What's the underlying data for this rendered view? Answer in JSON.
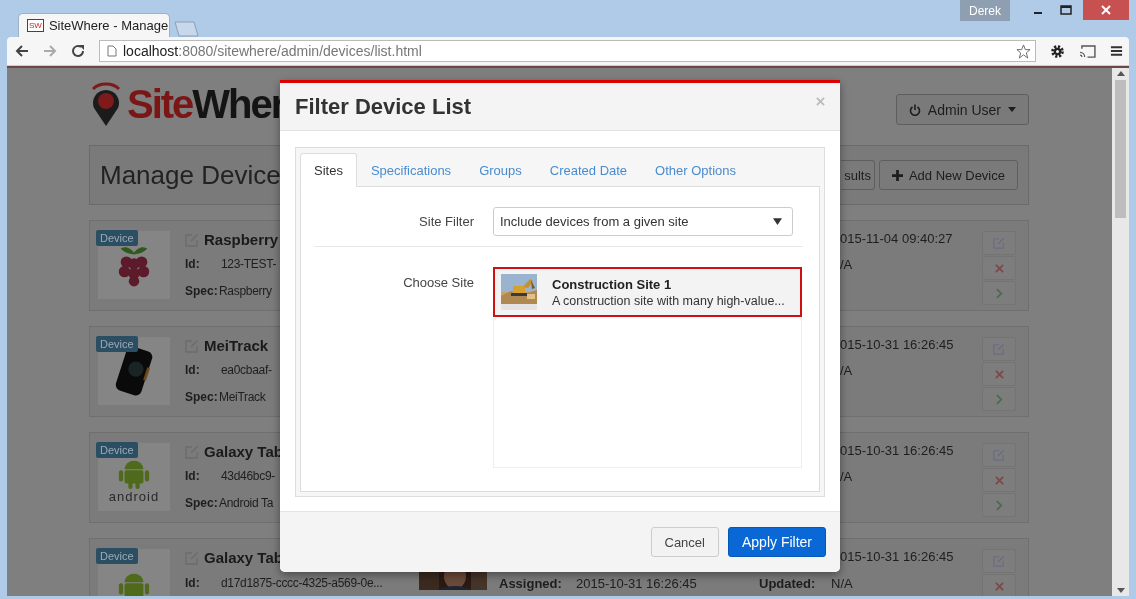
{
  "browser": {
    "tab_favicon": "SW",
    "tab_title": "SiteWhere - Manage",
    "profile": "Derek",
    "url_host": "localhost",
    "url_path": ":8080/sitewhere/admin/devices/list.html"
  },
  "page": {
    "logo": {
      "accent": "Site",
      "rest": "Wher"
    },
    "user_menu": "Admin User",
    "heading": "Manage Device",
    "toolbar_buttons": [
      {
        "label": "sults",
        "kind": "results"
      },
      {
        "label": "Add New Device",
        "kind": "add"
      }
    ],
    "devices": [
      {
        "badge": "Device",
        "image": {
          "kind": "raspberry"
        },
        "name": "Raspberry",
        "id_label": "Id:",
        "id": "123-TEST-",
        "spec_label": "Spec:",
        "spec": "Raspberry",
        "date": "015-11-04 09:40:27",
        "status": "/A",
        "actions": [
          {
            "kind": "edit"
          },
          {
            "kind": "delete"
          },
          {
            "kind": "open"
          }
        ]
      },
      {
        "badge": "Device",
        "image": {
          "kind": "tracker"
        },
        "name": "MeiTrack",
        "id_label": "Id:",
        "id": "ea0cbaaf-",
        "spec_label": "Spec:",
        "spec": "MeiTrack",
        "date": "015-10-31 16:26:45",
        "status": "/A",
        "actions": [
          {
            "kind": "edit"
          },
          {
            "kind": "delete"
          },
          {
            "kind": "open"
          }
        ]
      },
      {
        "badge": "Device",
        "image": {
          "kind": "android",
          "text": "android"
        },
        "name": "Galaxy Tab",
        "id_label": "Id:",
        "id": "43d46bc9-",
        "spec_label": "Spec:",
        "spec": "Android Ta",
        "date": "015-10-31 16:26:45",
        "status": "/A",
        "actions": [
          {
            "kind": "edit"
          },
          {
            "kind": "delete"
          },
          {
            "kind": "open"
          }
        ]
      },
      {
        "badge": "Device",
        "image": {
          "kind": "android"
        },
        "name": "Galaxy Tab",
        "id_label": "Id:",
        "id": "d17d1875-cccc-4325-a569-0e...",
        "photo": {
          "kind": "picture"
        },
        "assigned_label": "Assigned:",
        "assigned": "2015-10-31 16:26:45",
        "updated_label": "Updated:",
        "updated": "N/A",
        "date": "015-10-31 16:26:45",
        "actions": [
          {
            "kind": "edit"
          },
          {
            "kind": "delete"
          }
        ]
      }
    ]
  },
  "modal": {
    "title": "Filter Device List",
    "tabs": [
      {
        "label": "Sites",
        "selected": true
      },
      {
        "label": "Specifications",
        "selected": false
      },
      {
        "label": "Groups",
        "selected": false
      },
      {
        "label": "Created Date",
        "selected": false
      },
      {
        "label": "Other Options",
        "selected": false
      }
    ],
    "site_filter": {
      "label": "Site Filter",
      "value": "Include devices from a given site"
    },
    "choose_site": {
      "label": "Choose Site",
      "sites": [
        {
          "name": "Construction Site 1",
          "description": "A construction site with many high-value...",
          "selected": true
        }
      ]
    },
    "buttons": [
      {
        "label": "Cancel",
        "kind": "default"
      },
      {
        "label": "Apply Filter",
        "kind": "primary"
      }
    ]
  }
}
